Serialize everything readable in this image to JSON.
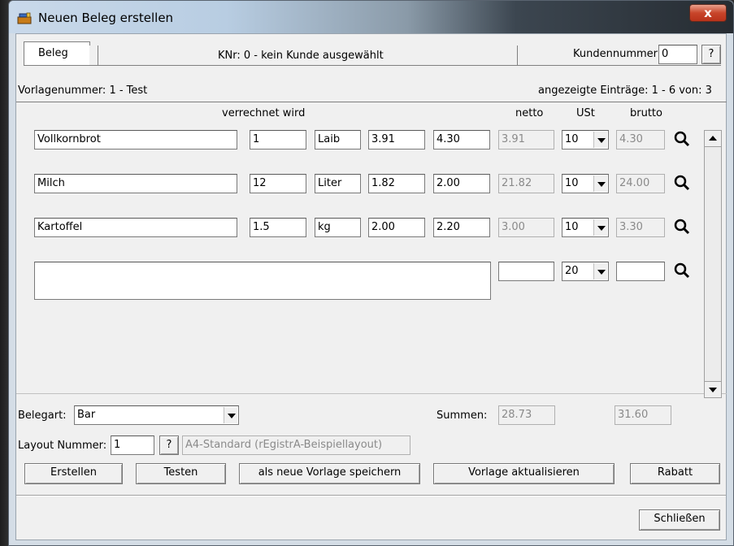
{
  "window": {
    "title": "Neuen Beleg erstellen",
    "close_label": "x"
  },
  "tabbar": {
    "tab_label": "Beleg",
    "customer_info": "KNr: 0 - kein Kunde ausgewählt",
    "kundennummer_label": "Kundennummer:",
    "kundennummer_value": "0",
    "help_label": "?"
  },
  "info": {
    "vorlage": "Vorlagenummer: 1 - Test",
    "entries": "angezeigte Einträge: 1 - 6 von: 3"
  },
  "headers": {
    "verrechnet": "verrechnet wird",
    "netto": "netto",
    "ust": "USt",
    "brutto": "brutto"
  },
  "rows": [
    {
      "name": "Vollkornbrot",
      "qty": "1",
      "unit": "Laib",
      "price": "3.91",
      "gross": "4.30",
      "netto": "3.91",
      "ust": "10",
      "brutto": "4.30"
    },
    {
      "name": "Milch",
      "qty": "12",
      "unit": "Liter",
      "price": "1.82",
      "gross": "2.00",
      "netto": "21.82",
      "ust": "10",
      "brutto": "24.00"
    },
    {
      "name": "Kartoffel",
      "qty": "1.5",
      "unit": "kg",
      "price": "2.00",
      "gross": "2.20",
      "netto": "3.00",
      "ust": "10",
      "brutto": "3.30"
    }
  ],
  "new_row": {
    "name": "",
    "netto": "",
    "ust": "20",
    "brutto": ""
  },
  "footer": {
    "belegart_label": "Belegart:",
    "belegart_value": "Bar",
    "summen_label": "Summen:",
    "summe_netto": "28.73",
    "summe_brutto": "31.60",
    "layout_label": "Layout Nummer:",
    "layout_value": "1",
    "layout_help": "?",
    "layout_name": "A4-Standard (rEgistrA-Beispiellayout)"
  },
  "buttons": {
    "erstellen": "Erstellen",
    "testen": "Testen",
    "neue_vorlage": "als neue Vorlage speichern",
    "vorlage_aktualisieren": "Vorlage aktualisieren",
    "rabatt": "Rabatt",
    "schliessen": "Schließen"
  },
  "icons": {
    "magnifier": "search-icon",
    "app": "cash-register-icon"
  },
  "colors": {
    "close_button": "#c8452a",
    "client_bg": "#f0f0f0",
    "disabled_text": "#8a8a8a"
  }
}
